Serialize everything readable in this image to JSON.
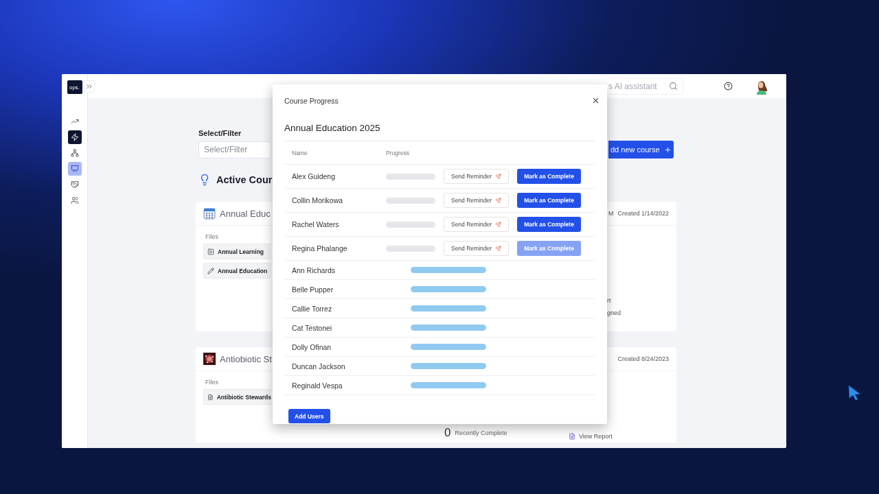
{
  "sidebar": {
    "logo": "ops.",
    "items": [
      {
        "kind": "plain",
        "selected": false
      },
      {
        "kind": "dark",
        "selected": true
      },
      {
        "kind": "plain",
        "selected": false
      },
      {
        "kind": "plain",
        "selected": true
      },
      {
        "kind": "plain",
        "selected": false
      },
      {
        "kind": "plain",
        "selected": false
      }
    ]
  },
  "topbar": {
    "search": {
      "placeholder": "s AI assistant"
    }
  },
  "filter": {
    "label": "Select/Filter",
    "placeholder": "Select/Filter"
  },
  "add_course_button": "dd new course",
  "section_title": "Active Cour",
  "courses": [
    {
      "title": "Annual Educ",
      "meta": "M",
      "created": "Created 1/14/2022",
      "files_label": "Files",
      "files": [
        {
          "kind": "video",
          "name": "Annual Learning"
        },
        {
          "kind": "edit",
          "name": "Annual Education"
        }
      ],
      "actions": [
        {
          "kind": "plain",
          "label": "rt"
        },
        {
          "kind": "plain",
          "label": "gned"
        }
      ]
    },
    {
      "title": "Antiobiotic St",
      "created": "Created 8/24/2023",
      "files_label": "Files",
      "files": [
        {
          "kind": "doc",
          "name": "Antibiotic Stewards"
        }
      ],
      "stats": [
        {
          "count": "0",
          "label": "Recently Complete"
        }
      ],
      "actions": [
        {
          "kind": "report",
          "label": "View Report"
        }
      ]
    }
  ],
  "modal": {
    "title": "Course Progress",
    "course": "Annual Education 2025",
    "columns": [
      "Name",
      "Progress"
    ],
    "rows": [
      {
        "kind": "pending",
        "name": "Alex Guideng",
        "level": 0,
        "reminder": "Send Reminder",
        "complete": "Mark as Complete",
        "disabled": false
      },
      {
        "kind": "pending",
        "name": "Collin Morikowa",
        "level": 0,
        "reminder": "Send Reminder",
        "complete": "Mark as Complete",
        "disabled": false
      },
      {
        "kind": "pending",
        "name": "Rachel Waters",
        "level": 0,
        "reminder": "Send Reminder",
        "complete": "Mark as Complete",
        "disabled": false
      },
      {
        "kind": "pending",
        "name": "Regina Phalange",
        "level": 0,
        "reminder": "Send Reminder",
        "complete": "Mark as Complete",
        "disabled": true
      },
      {
        "kind": "done",
        "name": "Ann Richards",
        "level": 1
      },
      {
        "kind": "done",
        "name": "Belle Pupper",
        "level": 1
      },
      {
        "kind": "done",
        "name": "Callie Torrez",
        "level": 1
      },
      {
        "kind": "done",
        "name": "Cat Testonei",
        "level": 1
      },
      {
        "kind": "done",
        "name": "Dolly Ofinan",
        "level": 1
      },
      {
        "kind": "done",
        "name": "Duncan Jackson",
        "level": 1
      },
      {
        "kind": "done",
        "name": "Reginald Vespa",
        "level": 1
      }
    ],
    "add_button": "Add Users"
  }
}
